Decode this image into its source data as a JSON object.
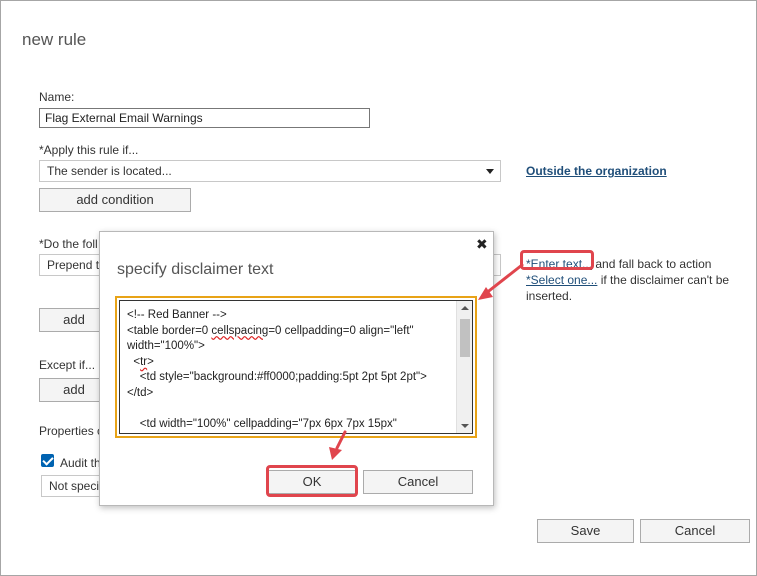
{
  "page": {
    "title": "new rule"
  },
  "form": {
    "name_label": "Name:",
    "name_value": "Flag External Email Warnings",
    "apply_label": "*Apply this rule if...",
    "apply_value": "The sender is located...",
    "apply_link": "Outside the organization",
    "add_condition": "add condition",
    "do_label": "*Do the foll",
    "do_value": "Prepend t",
    "add_action": "add",
    "action_link_enter": "*Enter text...",
    "action_text_1": " and fall back to action",
    "action_link_select": "*Select one...",
    "action_text_2": " if the disclaimer can't be",
    "action_text_3": "inserted.",
    "except_label": "Except if...",
    "add_exception": "add",
    "properties_label": "Properties c",
    "audit_label": "Audit th",
    "severity_value": "Not speci",
    "save": "Save",
    "cancel": "Cancel"
  },
  "modal": {
    "title": "specify disclaimer text",
    "code_lines": [
      "<!-- Red Banner -->",
      "<table border=0 ",
      "cellspacing",
      "=0 cellpadding=0 align=\"left\"",
      "width=\"100%\">",
      "  <",
      "tr",
      ">",
      "    <td style=\"background:#ff0000;padding:5pt 2pt 5pt 2pt\">",
      "</td>",
      "",
      "    <td width=\"100%\" cellpadding=\"7px 6px 7px 15px\""
    ],
    "ok": "OK",
    "cancel": "Cancel"
  },
  "colors": {
    "annotation_red": "#e0454d",
    "focus_border": "#e8a317",
    "link": "#1f4e79",
    "checkbox": "#0063b1"
  }
}
